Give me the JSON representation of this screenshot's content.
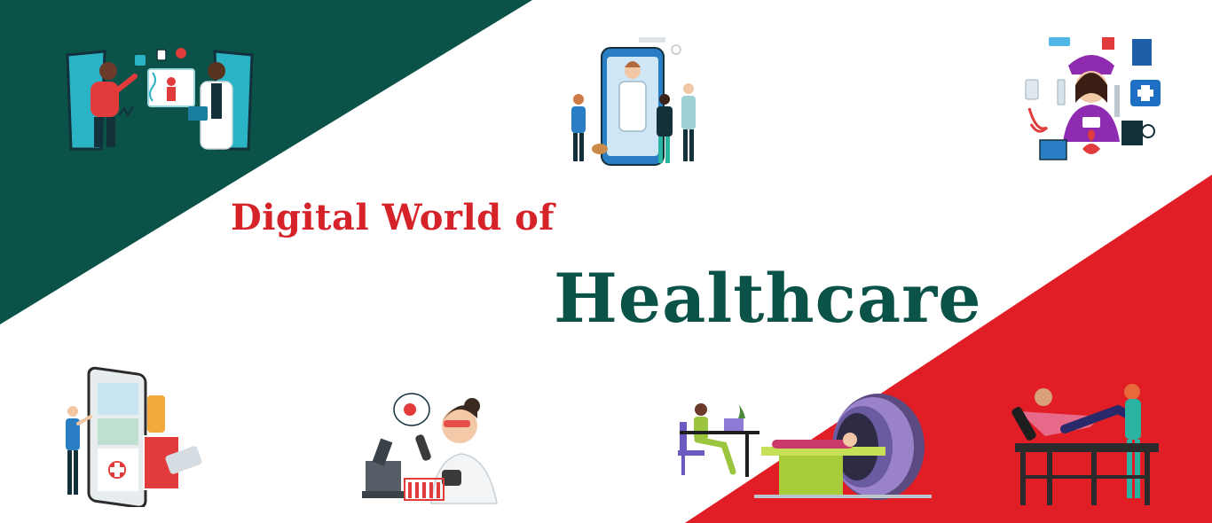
{
  "banner": {
    "heading_line1": "Digital World of",
    "heading_line2": "Healthcare"
  },
  "colors": {
    "dark_green": "#0b5248",
    "red": "#e11e26",
    "heading_red": "#d6232a",
    "white": "#ffffff"
  },
  "illustrations": [
    "telemedicine-consult-icon",
    "phone-doctor-video-call-icon",
    "nurse-medical-equipment-icon",
    "online-pharmacy-phone-icon",
    "lab-scientist-microscope-icon",
    "patient-working-laptop-icon",
    "mri-scanner-icon",
    "physiotherapy-bed-icon"
  ]
}
